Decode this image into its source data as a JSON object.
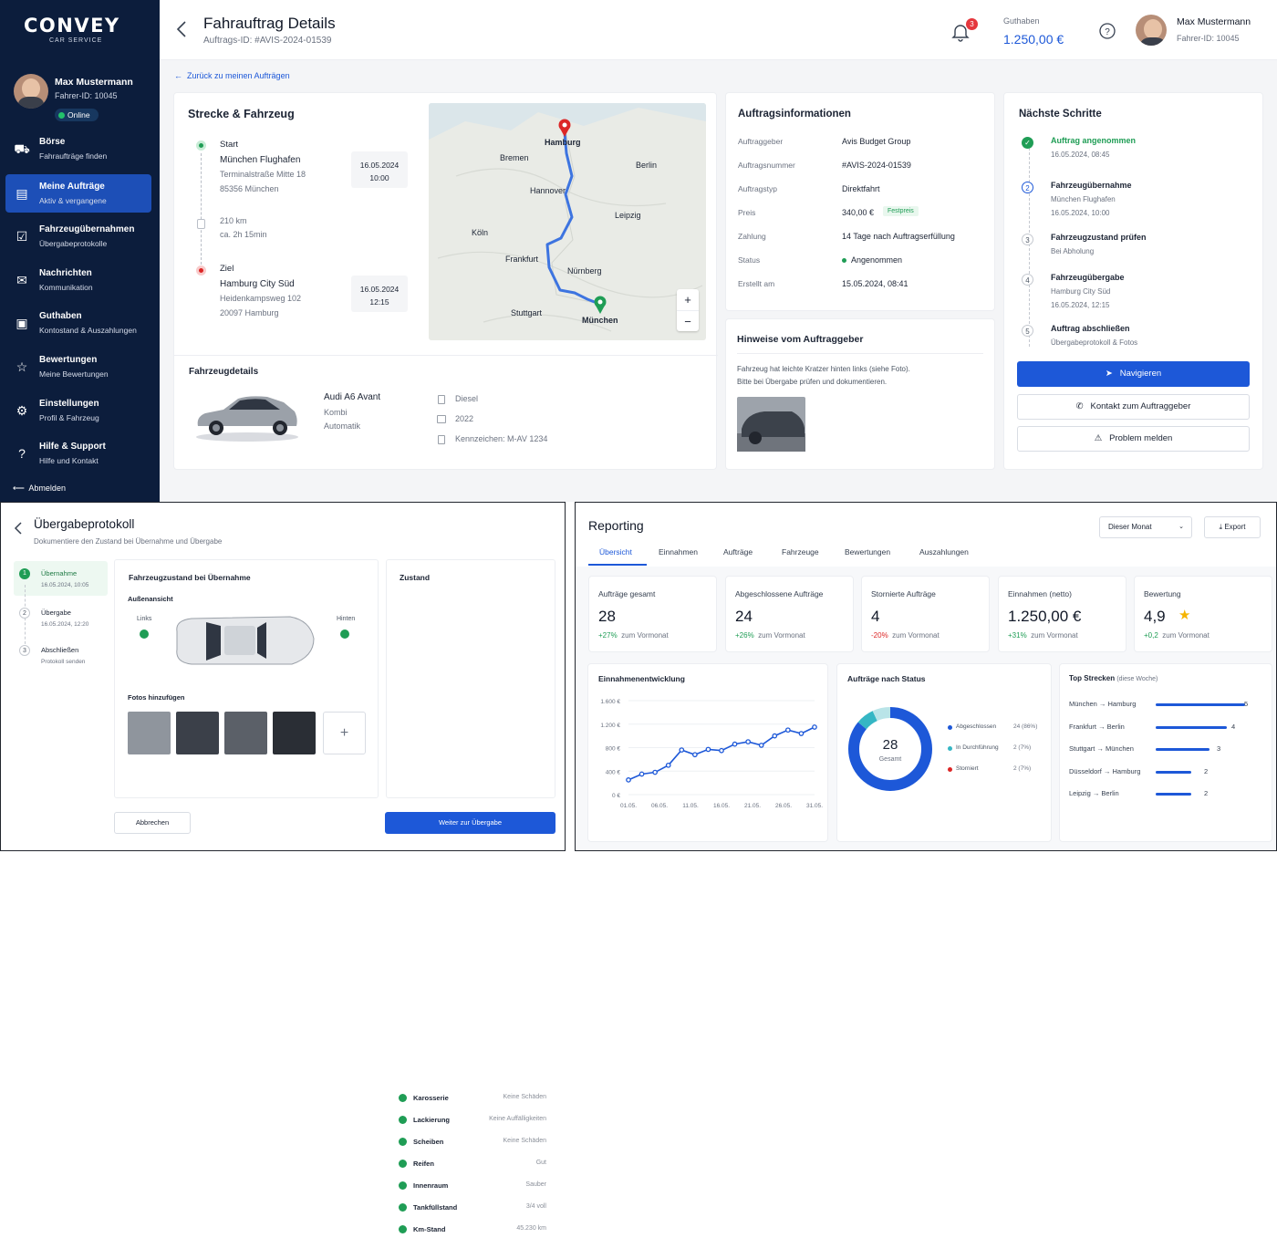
{
  "brand": {
    "name": "CONVEY",
    "sub": "CAR SERVICE"
  },
  "user": {
    "name": "Max Mustermann",
    "id": "Fahrer-ID: 10045",
    "status": "Online"
  },
  "sidebar": {
    "items": [
      {
        "title": "Börse",
        "sub": "Fahraufträge finden",
        "icon": "car-icon"
      },
      {
        "title": "Meine Aufträge",
        "sub": "Aktiv & vergangene",
        "icon": "clipboard-icon"
      },
      {
        "title": "Fahrzeugübernahmen",
        "sub": "Übergabeprotokolle",
        "icon": "checklist-icon"
      },
      {
        "title": "Nachrichten",
        "sub": "Kommunikation",
        "icon": "mail-icon"
      },
      {
        "title": "Guthaben",
        "sub": "Kontostand & Auszahlungen",
        "icon": "wallet-icon"
      },
      {
        "title": "Bewertungen",
        "sub": "Meine Bewertungen",
        "icon": "star-icon"
      },
      {
        "title": "Einstellungen",
        "sub": "Profil & Fahrzeug",
        "icon": "gear-icon"
      },
      {
        "title": "Hilfe & Support",
        "sub": "Hilfe und Kontakt",
        "icon": "help-icon"
      }
    ],
    "logout": "Abmelden"
  },
  "header": {
    "title": "Fahrauftrag Details",
    "subtitle": "Auftrags-ID: #AVIS-2024-01539",
    "notif_count": "3",
    "balance_label": "Guthaben",
    "balance": "1.250,00 €",
    "user_name": "Max Mustermann",
    "user_id": "Fahrer-ID: 10045"
  },
  "back_link": "Zurück zu meinen Aufträgen",
  "route": {
    "title": "Strecke & Fahrzeug",
    "start": {
      "label": "Start",
      "name": "München Flughafen",
      "street": "Terminalstraße Mitte 18",
      "city": "85356 München",
      "date": "16.05.2024",
      "time": "10:00"
    },
    "distance": "210 km",
    "duration": "ca. 2h 15min",
    "end": {
      "label": "Ziel",
      "name": "Hamburg City Süd",
      "street": "Heidenkampsweg 102",
      "city": "20097 Hamburg",
      "date": "16.05.2024",
      "time": "12:15"
    }
  },
  "map": {
    "cities": [
      "Hamburg",
      "Bremen",
      "Berlin",
      "Hannover",
      "Leipzig",
      "Köln",
      "Frankfurt",
      "Nürnberg",
      "Stuttgart",
      "München"
    ],
    "zoom_in": "+",
    "zoom_out": "−"
  },
  "vehicle": {
    "title": "Fahrzeugdetails",
    "model": "Audi A6 Avant",
    "type": "Kombi",
    "transmission": "Automatik",
    "fuel": "Diesel",
    "year": "2022",
    "plate": "Kennzeichen: M-AV 1234"
  },
  "info": {
    "title": "Auftragsinformationen",
    "rows": [
      {
        "k": "Auftraggeber",
        "v": "Avis Budget Group"
      },
      {
        "k": "Auftragsnummer",
        "v": "#AVIS-2024-01539"
      },
      {
        "k": "Auftragstyp",
        "v": "Direktfahrt"
      },
      {
        "k": "Preis",
        "v": "340,00 €",
        "badge": "Festpreis"
      },
      {
        "k": "Zahlung",
        "v": "14 Tage nach Auftragserfüllung"
      },
      {
        "k": "Status",
        "v": "Angenommen"
      },
      {
        "k": "Erstellt am",
        "v": "15.05.2024, 08:41"
      }
    ]
  },
  "notes": {
    "title": "Hinweise vom Auftraggeber",
    "text1": "Fahrzeug hat leichte Kratzer hinten links (siehe Foto).",
    "text2": "Bitte bei Übergabe prüfen und dokumentieren."
  },
  "steps": {
    "title": "Nächste Schritte",
    "items": [
      {
        "n": "✓",
        "title": "Auftrag angenommen",
        "l1": "16.05.2024, 08:45",
        "l2": ""
      },
      {
        "n": "2",
        "title": "Fahrzeugübernahme",
        "l1": "München Flughafen",
        "l2": "16.05.2024, 10:00"
      },
      {
        "n": "3",
        "title": "Fahrzeugzustand prüfen",
        "l1": "Bei Abholung",
        "l2": ""
      },
      {
        "n": "4",
        "title": "Fahrzeugübergabe",
        "l1": "Hamburg City Süd",
        "l2": "16.05.2024, 12:15"
      },
      {
        "n": "5",
        "title": "Auftrag abschließen",
        "l1": "Übergabeprotokoll & Fotos",
        "l2": ""
      }
    ],
    "navigate": "Navigieren",
    "contact": "Kontakt zum Auftraggeber",
    "problem": "Problem melden"
  },
  "protocol": {
    "title": "Übergabeprotokoll",
    "subtitle": "Dokumentiere den Zustand bei Übernahme und Übergabe",
    "steps": [
      {
        "n": "1",
        "t": "Übernahme",
        "s": "16.05.2024, 10:05"
      },
      {
        "n": "2",
        "t": "Übergabe",
        "s": "16.05.2024, 12:20"
      },
      {
        "n": "3",
        "t": "Abschließen",
        "s": "Protokoll senden"
      }
    ],
    "condition_title": "Fahrzeugzustand bei Übernahme",
    "exterior": "Außenansicht",
    "left": "Links",
    "rear": "Hinten",
    "photos": "Fotos hinzufügen",
    "add": "+",
    "status_title": "Zustand",
    "status": [
      {
        "k": "Karosserie",
        "v": "Keine Schäden"
      },
      {
        "k": "Lackierung",
        "v": "Keine Auffälligkeiten"
      },
      {
        "k": "Scheiben",
        "v": "Keine Schäden"
      },
      {
        "k": "Reifen",
        "v": "Gut"
      },
      {
        "k": "Innenraum",
        "v": "Sauber"
      },
      {
        "k": "Tankfüllstand",
        "v": "3/4 voll"
      },
      {
        "k": "Km-Stand",
        "v": "45.230 km"
      }
    ],
    "cancel": "Abbrechen",
    "next": "Weiter zur Übergabe"
  },
  "reporting": {
    "title": "Reporting",
    "period": "Dieser Monat",
    "export": "Export",
    "tabs": [
      "Übersicht",
      "Einnahmen",
      "Aufträge",
      "Fahrzeuge",
      "Bewertungen",
      "Auszahlungen"
    ],
    "kpis": [
      {
        "t": "Aufträge gesamt",
        "v": "28",
        "d": "+27%",
        "s": "zum Vormonat"
      },
      {
        "t": "Abgeschlossene Aufträge",
        "v": "24",
        "d": "+26%",
        "s": "zum Vormonat"
      },
      {
        "t": "Stornierte Aufträge",
        "v": "4",
        "d": "-20%",
        "s": "zum Vormonat"
      },
      {
        "t": "Einnahmen (netto)",
        "v": "1.250,00 €",
        "d": "+31%",
        "s": "zum Vormonat"
      },
      {
        "t": "Bewertung",
        "v": "4,9",
        "d": "+0,2",
        "s": "zum Vormonat"
      }
    ],
    "status_title": "Aufträge nach Status",
    "donut_total": "28",
    "donut_label": "Gesamt",
    "status_legend": [
      {
        "n": "Abgeschlossen",
        "v": "24 (86%)",
        "c": "#1d58d8"
      },
      {
        "n": "In Durchführung",
        "v": "2 (7%)",
        "c": "#35b6c4"
      },
      {
        "n": "Storniert",
        "v": "2 (7%)",
        "c": "#dc2626"
      }
    ],
    "routes_title": "Top Strecken",
    "routes_sub": "(diese Woche)",
    "routes": [
      {
        "r": "München → Hamburg",
        "v": 5
      },
      {
        "r": "Frankfurt → Berlin",
        "v": 4
      },
      {
        "r": "Stuttgart → München",
        "v": 3
      },
      {
        "r": "Düsseldorf → Hamburg",
        "v": 2
      },
      {
        "r": "Leipzig → Berlin",
        "v": 2
      }
    ]
  },
  "chart_data": {
    "type": "line",
    "title": "Einnahmenentwicklung",
    "x": [
      "01.05.",
      "02.05.",
      "03.05.",
      "04.05.",
      "05.05.",
      "06.05.",
      "07.05.",
      "08.05.",
      "09.05.",
      "10.05.",
      "11.05.",
      "12.05.",
      "13.05.",
      "14.05.",
      "15.05.",
      "16.05.",
      "17.05.",
      "18.05.",
      "19.05.",
      "20.05.",
      "21.05.",
      "22.05.",
      "23.05.",
      "24.05.",
      "25.05.",
      "26.05.",
      "27.05.",
      "28.05.",
      "29.05.",
      "30.05.",
      "31.05."
    ],
    "values": [
      null,
      null,
      null,
      250,
      null,
      null,
      350,
      null,
      null,
      null,
      520,
      null,
      null,
      null,
      null,
      null,
      null,
      null,
      null,
      null,
      null,
      null,
      null,
      null,
      null,
      null,
      null,
      null,
      null,
      null,
      null
    ],
    "series": [
      {
        "values": [
          250,
          350,
          380,
          500,
          760,
          680,
          770,
          750,
          860,
          900,
          840,
          1000,
          1100,
          1040,
          1150
        ]
      }
    ],
    "xticks": [
      "01.05.",
      "06.05.",
      "11.05.",
      "16.05.",
      "21.05.",
      "26.05.",
      "31.05."
    ],
    "yticks": [
      "0 €",
      "400 €",
      "800 €",
      "1.200 €",
      "1.600 €"
    ],
    "ylim": [
      0,
      1600
    ]
  }
}
